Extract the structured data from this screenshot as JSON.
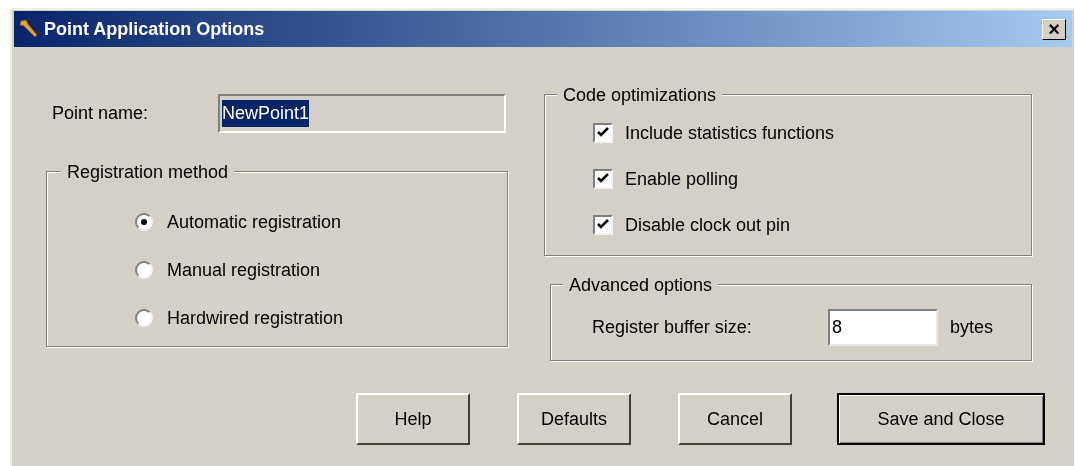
{
  "window": {
    "title": "Point Application Options",
    "close_label": "×"
  },
  "point_name": {
    "label": "Point name:",
    "value": "NewPoint1",
    "selected": true
  },
  "registration": {
    "title": "Registration method",
    "options": [
      {
        "label": "Automatic registration",
        "selected": true
      },
      {
        "label": "Manual registration",
        "selected": false
      },
      {
        "label": "Hardwired registration",
        "selected": false
      }
    ]
  },
  "code_optimizations": {
    "title": "Code optimizations",
    "options": [
      {
        "label": "Include statistics functions",
        "checked": true
      },
      {
        "label": "Enable polling",
        "checked": true
      },
      {
        "label": "Disable clock out pin",
        "checked": true
      }
    ]
  },
  "advanced": {
    "title": "Advanced options",
    "label": "Register buffer size:",
    "value": "8",
    "unit": "bytes"
  },
  "buttons": [
    {
      "label": "Help",
      "default": false
    },
    {
      "label": "Defaults",
      "default": false
    },
    {
      "label": "Cancel",
      "default": false
    },
    {
      "label": "Save and Close",
      "default": true
    }
  ]
}
